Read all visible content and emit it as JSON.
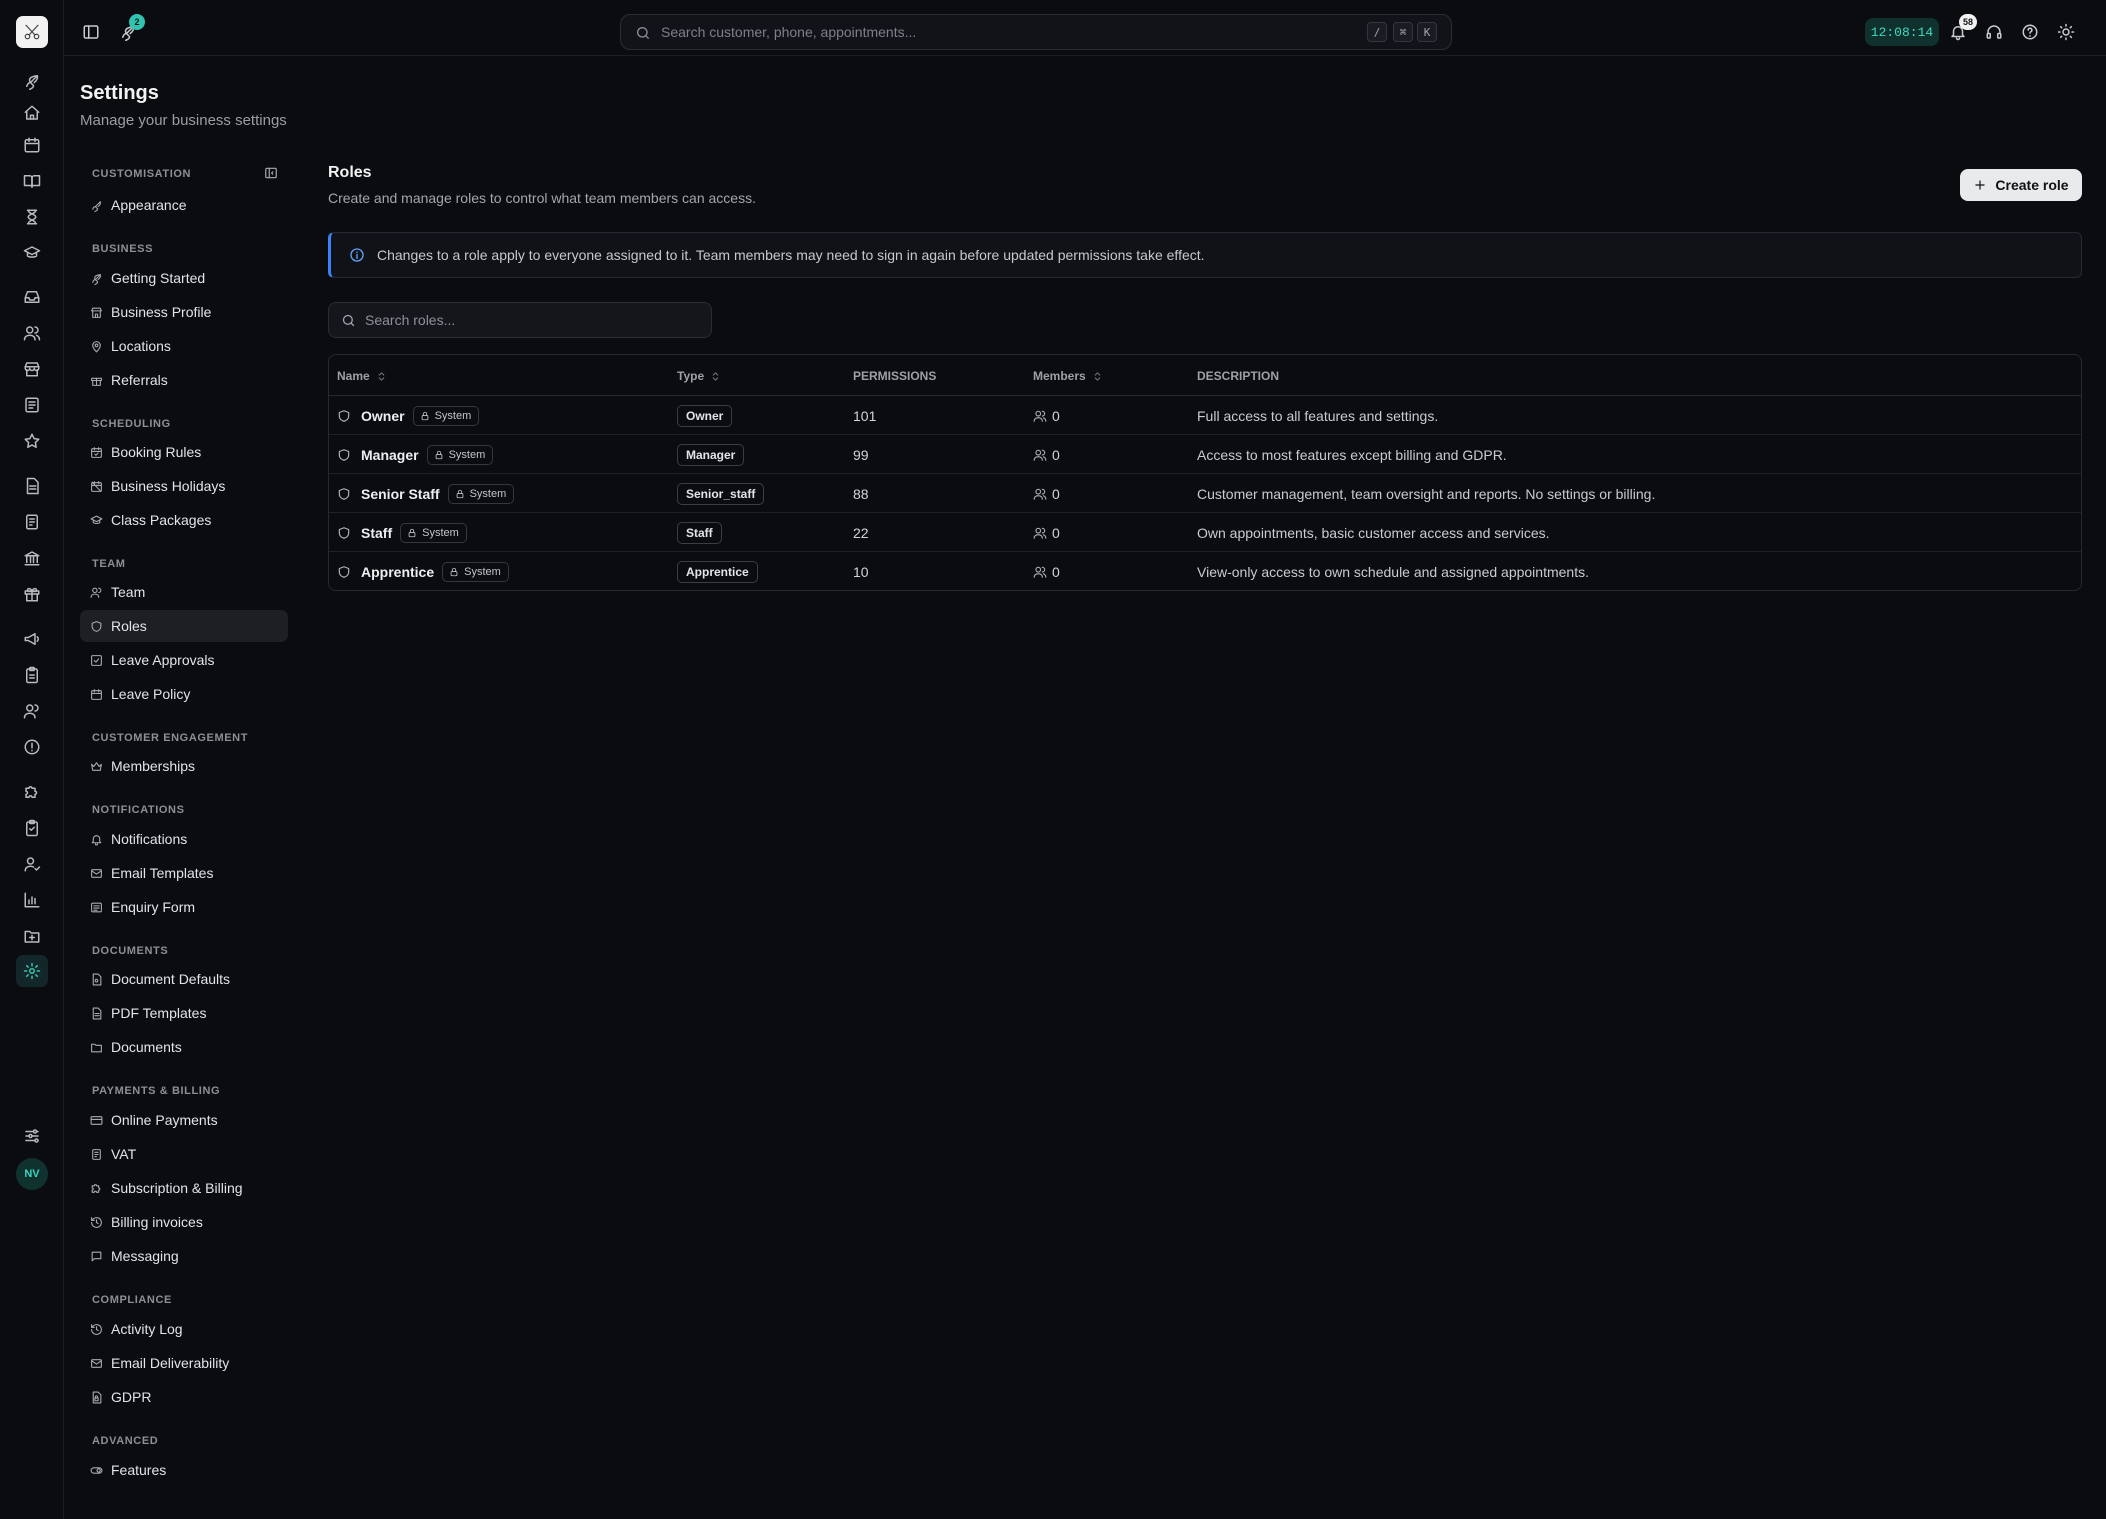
{
  "topbar": {
    "notif_rocket_count": "2",
    "search_placeholder": "Search customer, phone, appointments...",
    "kbd": [
      "/",
      "⌘",
      "K"
    ],
    "clock": "12:08:14",
    "bell_count": "58"
  },
  "rail": {
    "avatar_initials": "NV"
  },
  "page": {
    "title": "Settings",
    "subtitle": "Manage your business settings"
  },
  "nav": {
    "sections": {
      "customisation": "CUSTOMISATION",
      "business": "BUSINESS",
      "scheduling": "SCHEDULING",
      "team": "TEAM",
      "customer_engagement": "CUSTOMER ENGAGEMENT",
      "notifications": "NOTIFICATIONS",
      "documents": "DOCUMENTS",
      "payments": "PAYMENTS & BILLING",
      "compliance": "COMPLIANCE",
      "advanced": "ADVANCED"
    },
    "items": {
      "appearance": "Appearance",
      "getting_started": "Getting Started",
      "business_profile": "Business Profile",
      "locations": "Locations",
      "referrals": "Referrals",
      "booking_rules": "Booking Rules",
      "business_holidays": "Business Holidays",
      "class_packages": "Class Packages",
      "team": "Team",
      "roles": "Roles",
      "leave_approvals": "Leave Approvals",
      "leave_policy": "Leave Policy",
      "memberships": "Memberships",
      "notifications": "Notifications",
      "email_templates": "Email Templates",
      "enquiry_form": "Enquiry Form",
      "document_defaults": "Document Defaults",
      "pdf_templates": "PDF Templates",
      "documents": "Documents",
      "online_payments": "Online Payments",
      "vat": "VAT",
      "subscription_billing": "Subscription & Billing",
      "billing_invoices": "Billing invoices",
      "messaging": "Messaging",
      "activity_log": "Activity Log",
      "email_deliverability": "Email Deliverability",
      "gdpr": "GDPR",
      "features": "Features"
    }
  },
  "roles": {
    "title": "Roles",
    "subtitle": "Create and manage roles to control what team members can access.",
    "create_label": "Create role",
    "info": "Changes to a role apply to everyone assigned to it. Team members may need to sign in again before updated permissions take effect.",
    "search_placeholder": "Search roles...",
    "columns": {
      "name": "Name",
      "type": "Type",
      "permissions": "PERMISSIONS",
      "members": "Members",
      "description": "DESCRIPTION"
    },
    "rows": [
      {
        "name": "Owner",
        "badge": "System",
        "type": "Owner",
        "permissions": "101",
        "members": "0",
        "description": "Full access to all features and settings."
      },
      {
        "name": "Manager",
        "badge": "System",
        "type": "Manager",
        "permissions": "99",
        "members": "0",
        "description": "Access to most features except billing and GDPR."
      },
      {
        "name": "Senior Staff",
        "badge": "System",
        "type": "Senior_staff",
        "permissions": "88",
        "members": "0",
        "description": "Customer management, team oversight and reports. No settings or billing."
      },
      {
        "name": "Staff",
        "badge": "System",
        "type": "Staff",
        "permissions": "22",
        "members": "0",
        "description": "Own appointments, basic customer access and services."
      },
      {
        "name": "Apprentice",
        "badge": "System",
        "type": "Apprentice",
        "permissions": "10",
        "members": "0",
        "description": "View-only access to own schedule and assigned appointments."
      }
    ]
  },
  "colors": {
    "background": "#0b0c10",
    "accent": "#35c2b1",
    "info": "#3b82f6"
  }
}
